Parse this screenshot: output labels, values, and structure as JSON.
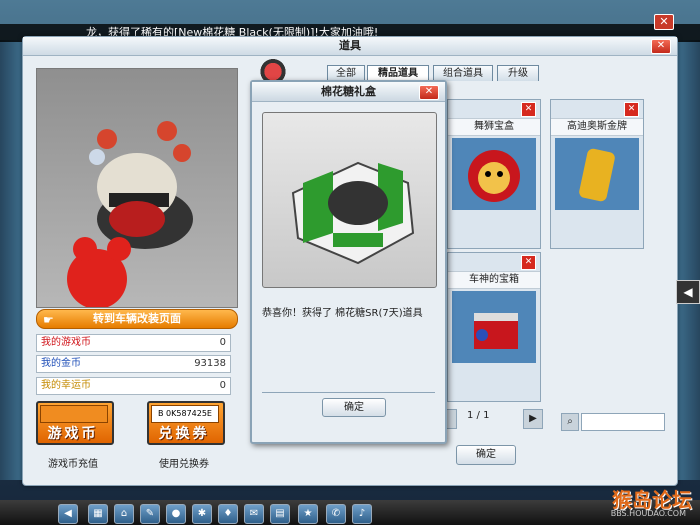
{
  "broadcast": {
    "text": "龙，获得了稀有的[New棉花糖 Black(无限制)]!大家加油哦!"
  },
  "window": {
    "title": "道具",
    "close": "✕"
  },
  "left_panel": {
    "promo_button": "转到车辆改装页面",
    "stats": [
      {
        "label": "我的游戏币",
        "value": "0"
      },
      {
        "label": "我的金币",
        "value": "93138"
      },
      {
        "label": "我的幸运币",
        "value": "0"
      }
    ],
    "recharge_button": "游戏币",
    "recharge_caption": "游戏币充值",
    "coupon_button": "兑换券",
    "coupon_caption": "使用兑换券",
    "coupon_code": "B  0K587425E"
  },
  "tabs": [
    "全部",
    "精品道具",
    "组合道具",
    "升级"
  ],
  "items": [
    {
      "title": "舞狮宝盒",
      "close": "✕"
    },
    {
      "title": "高迪奥斯金牌",
      "close": "✕"
    },
    {
      "title": "车神的宝箱",
      "close": "✕"
    }
  ],
  "pager": {
    "text": "1 / 1",
    "next": "▶"
  },
  "confirm_main": "确定",
  "popup": {
    "title": "棉花糖礼盒",
    "close": "✕",
    "message": "恭喜你！获得了 棉花糖SR(7天)道具",
    "confirm": "确定"
  },
  "side_arrow": "◀",
  "watermark": {
    "text": "猴岛论坛",
    "sub": "BBS.HOUDAO.COM"
  },
  "colors": {
    "accent_orange": "#e67c00",
    "close_red": "#c32a1b",
    "panel_bg": "#e8eef3"
  }
}
